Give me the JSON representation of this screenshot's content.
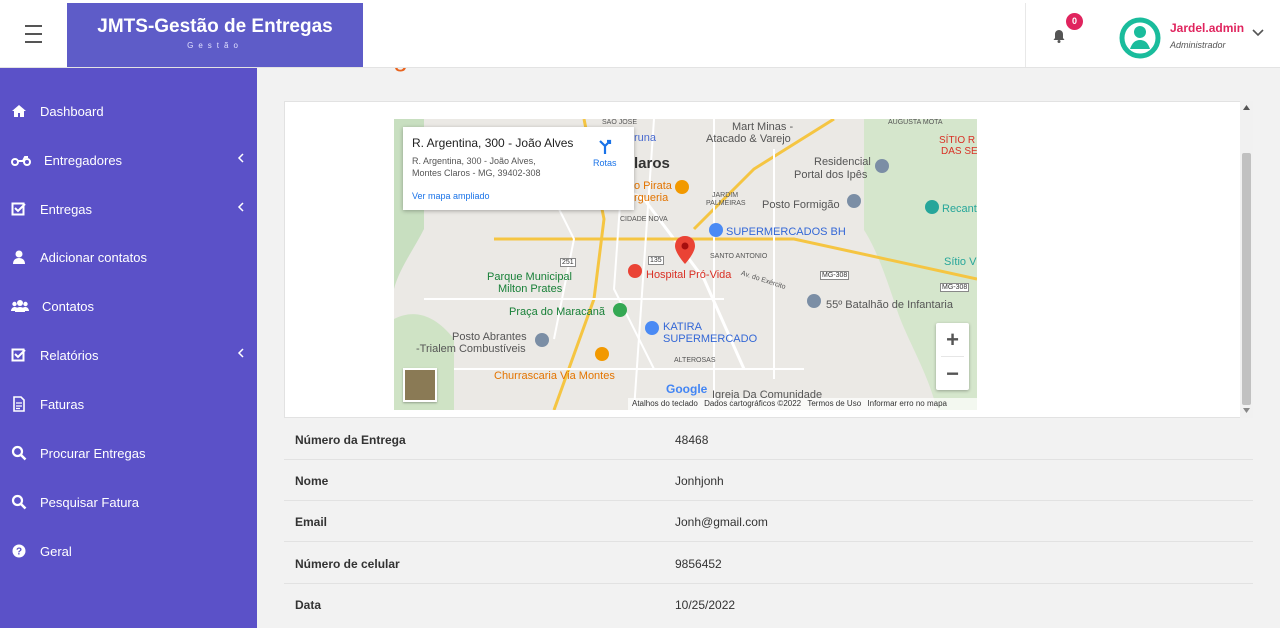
{
  "header": {
    "brand_title": "JMTS-Gestão de Entregas",
    "brand_subtitle": "Gestão",
    "notification_count": "0",
    "user_name": "Jardel.admin",
    "user_role": "Administrador"
  },
  "sidebar": {
    "items": [
      {
        "label": "Dashboard",
        "icon": "home-icon",
        "has_submenu": false
      },
      {
        "label": "Entregadores",
        "icon": "motorcycle-icon",
        "has_submenu": true
      },
      {
        "label": "Entregas",
        "icon": "checkbox-icon",
        "has_submenu": true
      },
      {
        "label": "Adicionar contatos",
        "icon": "user-icon",
        "has_submenu": false
      },
      {
        "label": "Contatos",
        "icon": "users-icon",
        "has_submenu": false
      },
      {
        "label": "Relatórios",
        "icon": "checkbox-icon",
        "has_submenu": true
      },
      {
        "label": "Faturas",
        "icon": "file-icon",
        "has_submenu": false
      },
      {
        "label": "Procurar Entregas",
        "icon": "search-icon",
        "has_submenu": false
      },
      {
        "label": "Pesquisar Fatura",
        "icon": "search-icon",
        "has_submenu": false
      },
      {
        "label": "Geral",
        "icon": "question-icon",
        "has_submenu": false
      }
    ]
  },
  "page": {
    "title": "Ver Entregas"
  },
  "map": {
    "place_title": "R. Argentina, 300 - João Alves",
    "place_address_line1": "R. Argentina, 300 - João Alves,",
    "place_address_line2": "Montes Claros - MG, 39402-308",
    "directions_label": "Rotas",
    "larger_map_link": "Ver mapa ampliado",
    "zoom_in": "+",
    "zoom_out": "−",
    "google_logo": "Google",
    "footer": {
      "shortcuts": "Atalhos do teclado",
      "map_data": "Dados cartográficos ©2022",
      "terms": "Termos de Uso",
      "report": "Informar erro no mapa"
    },
    "labels": {
      "sao_jose": "SÃO JOSÉ",
      "augusta_mota": "AUGUSTA MOTA",
      "mart_minas_1": "Mart Minas -",
      "mart_minas_2": "Atacado & Varejo",
      "sitio_1": "SÍTIO R",
      "sitio_2": "DAS SE",
      "runa": "runa",
      "claros": "laros",
      "residencial_1": "Residencial",
      "residencial_2": "Portal dos Ipês",
      "pirata_1": "o Pirata",
      "pirata_2": "rgueria",
      "jardim_1": "JARDIM",
      "jardim_2": "PALMEIRAS",
      "posto_formigao": "Posto Formigão",
      "recant": "Recant",
      "cidade_nova": "CIDADE NOVA",
      "supermercados_bh": "SUPERMERCADOS BH",
      "road_251": "251",
      "road_135": "135",
      "santo_antonio": "SANTO ANTONIO",
      "sitio_v": "Sítio V",
      "parque_1": "Parque Municipal",
      "parque_2": "Milton Prates",
      "hospital": "Hospital Pró-Vida",
      "mg308_1": "MG-308",
      "mg308_2": "MG-308",
      "av_exercito": "Av. do Exército",
      "batalhao": "55º Batalhão de Infantaria",
      "praca": "Praça do Maracanã",
      "katira_1": "KATIRA",
      "katira_2": "SUPERMERCADO",
      "posto_abrantes_1": "Posto Abrantes",
      "posto_abrantes_2": "-Trialem Combustíveis",
      "alterosas": "ALTEROSAS",
      "churrascaria": "Churrascaria Via Montes",
      "igreja": "Igreja Da Comunidade"
    }
  },
  "details": [
    {
      "label": "Número da Entrega",
      "value": "48468"
    },
    {
      "label": "Nome",
      "value": "Jonhjonh"
    },
    {
      "label": "Email",
      "value": "Jonh@gmail.com"
    },
    {
      "label": "Número de celular",
      "value": "9856452"
    },
    {
      "label": "Data",
      "value": "10/25/2022"
    }
  ],
  "colors": {
    "sidebar": "#5b51c8",
    "brand": "#5e5cc8",
    "accent": "#e0245e",
    "title": "#e8641f",
    "avatar": "#1abc9c"
  }
}
